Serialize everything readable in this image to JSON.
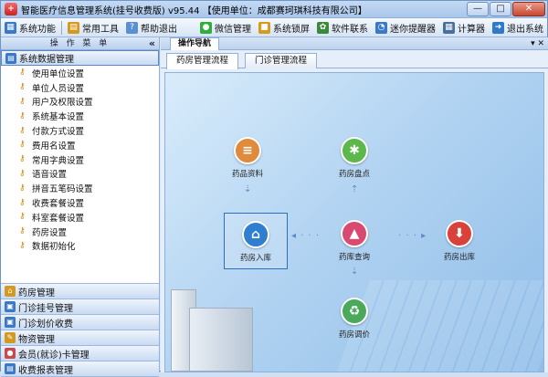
{
  "titlebar": {
    "title": "智能医疗信息管理系统(挂号收费版) v95.44  【使用单位：成都赛珂琪科技有限公司】",
    "minimize": "—",
    "maximize": "□",
    "close": "✕"
  },
  "toolbar": {
    "left": [
      {
        "label": "系统功能",
        "icon": "grid-icon",
        "color": "#3a78c8"
      },
      {
        "label": "常用工具",
        "icon": "toolbox-icon",
        "color": "#d49a20"
      },
      {
        "label": "帮助退出",
        "icon": "help-icon",
        "color": "#5a8fd0"
      }
    ],
    "right": [
      {
        "label": "微信管理",
        "icon": "wechat-icon",
        "color": "#2fae3c"
      },
      {
        "label": "系统锁屏",
        "icon": "lock-icon",
        "color": "#d89a18"
      },
      {
        "label": "软件联系",
        "icon": "contact-icon",
        "color": "#3b8a3b"
      },
      {
        "label": "迷你提醒器",
        "icon": "reminder-icon",
        "color": "#3a78c8"
      },
      {
        "label": "计算器",
        "icon": "calculator-icon",
        "color": "#4a6f9c"
      },
      {
        "label": "退出系统",
        "icon": "exit-icon",
        "color": "#2f79c6"
      }
    ]
  },
  "sidebar": {
    "header": "操 作 菜 单",
    "collapse": "«",
    "top_group": "系统数据管理",
    "items": [
      "使用单位设置",
      "单位人员设置",
      "用户及权限设置",
      "系统基本设置",
      "付款方式设置",
      "费用名设置",
      "常用字典设置",
      "语音设置",
      "拼音五笔码设置",
      "收费套餐设置",
      "料室套餐设置",
      "药房设置",
      "数据初始化"
    ],
    "groups": [
      {
        "label": "药房管理",
        "color": "#d49a20"
      },
      {
        "label": "门诊挂号管理",
        "color": "#3a78c8"
      },
      {
        "label": "门诊划价收费",
        "color": "#3a78c8"
      },
      {
        "label": "物资管理",
        "color": "#d49a20"
      },
      {
        "label": "会员(就诊)卡管理",
        "color": "#c84a4a"
      },
      {
        "label": "收费报表管理",
        "color": "#3a78c8"
      }
    ]
  },
  "main": {
    "nav_tab": "操作导航",
    "nav_ctl": "▾ ✕",
    "tabs": [
      "药房管理流程",
      "门诊管理流程"
    ],
    "flow": {
      "drug_info": {
        "label": "药品资料",
        "color": "#e08a3c"
      },
      "pharmacy_check": {
        "label": "药房盘点",
        "color": "#5cb84a"
      },
      "pharmacy_in": {
        "label": "药房入库",
        "color": "#2f7fd0"
      },
      "stock_query": {
        "label": "药库查询",
        "color": "#d84a72"
      },
      "pharmacy_out": {
        "label": "药房出库",
        "color": "#d8423a"
      },
      "pharmacy_transfer": {
        "label": "药房调价",
        "color": "#4aaa5a"
      }
    }
  }
}
